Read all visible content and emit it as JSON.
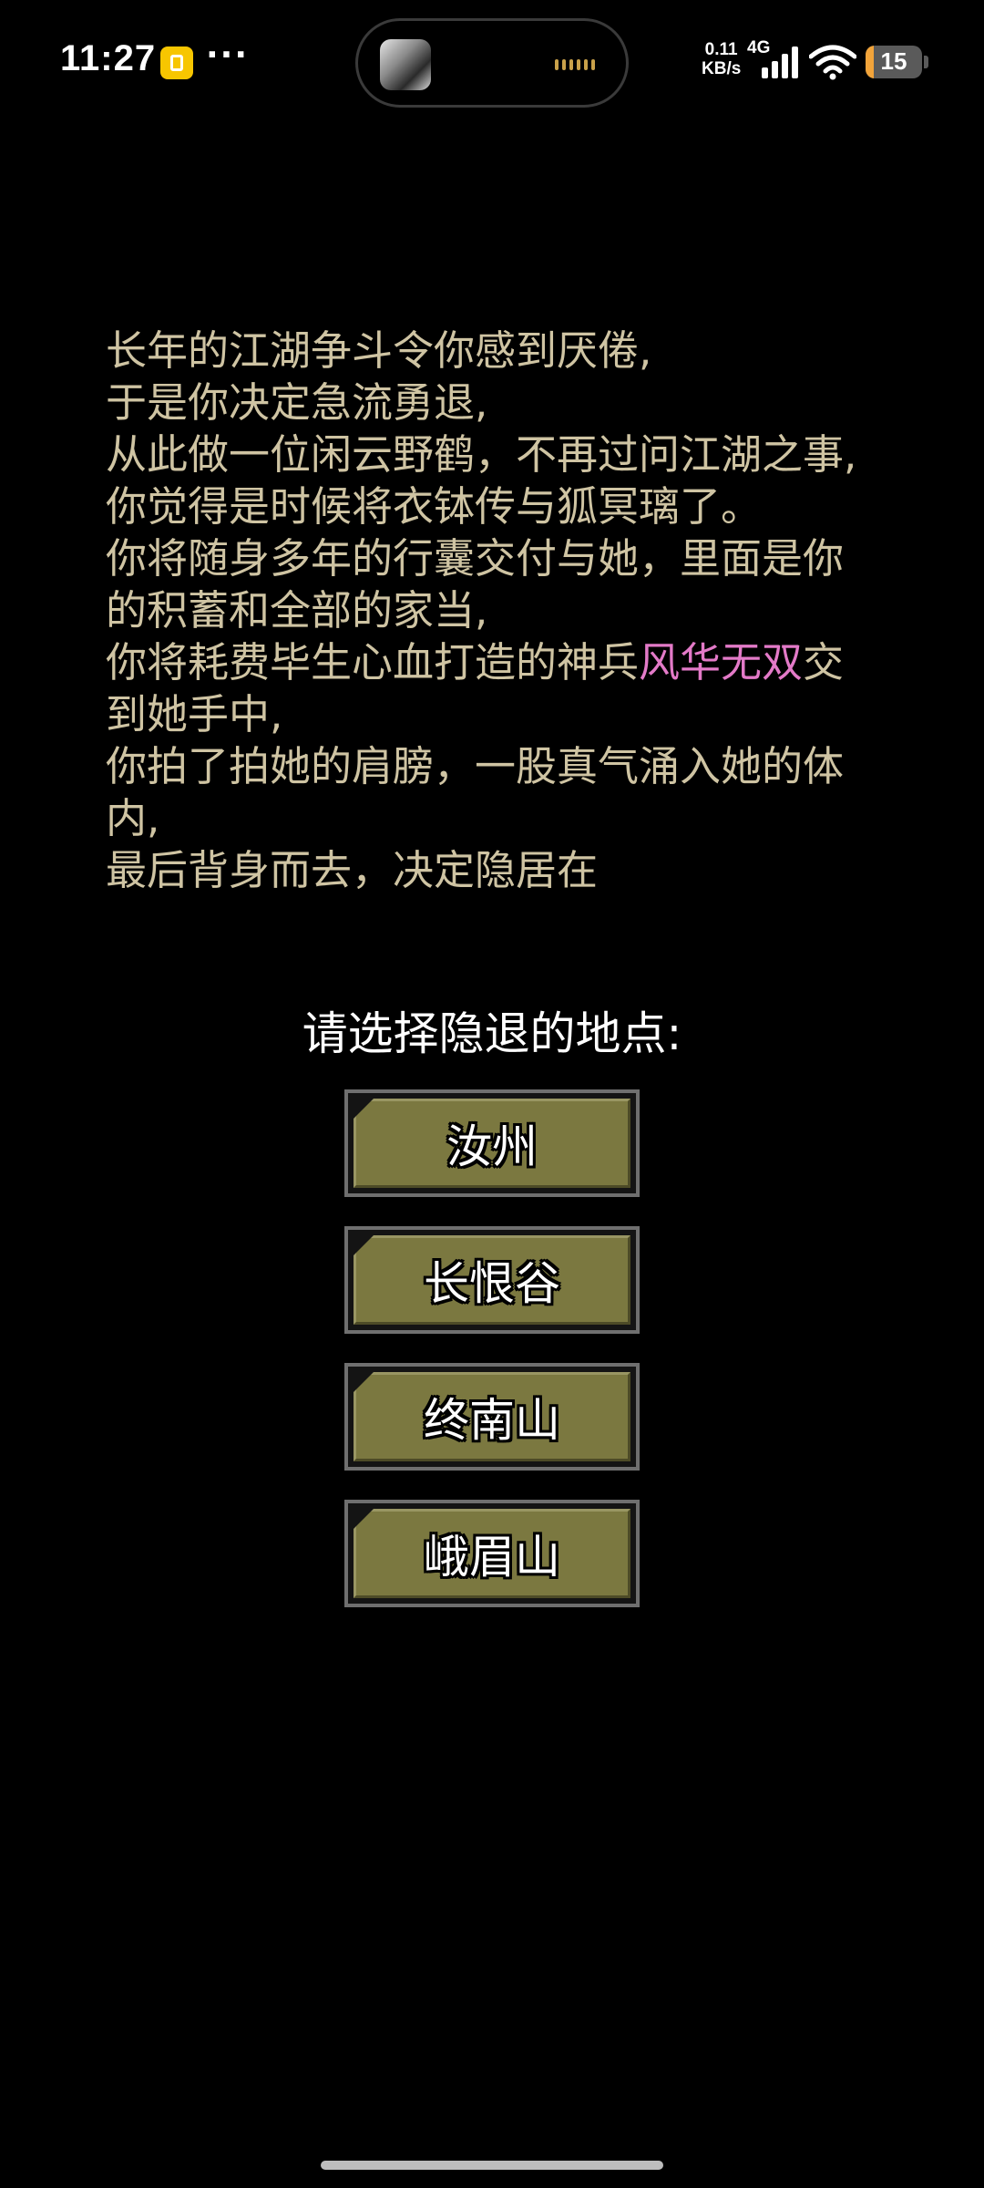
{
  "status_bar": {
    "time": "11:27",
    "more": "···",
    "net_speed_value": "0.11",
    "net_speed_unit": "KB/s",
    "net_type": "4G",
    "battery": "15",
    "battery_level_percent": 15,
    "battery_color": "#f2a43a",
    "icons": [
      "app-notification-icon",
      "signal-icon",
      "wifi-icon",
      "battery-icon"
    ]
  },
  "story": {
    "lines": [
      "长年的江湖争斗令你感到厌倦,",
      "于是你决定急流勇退,",
      "从此做一位闲云野鹤，不再过问江湖之事,",
      "你觉得是时候将衣钵传与狐冥璃了。",
      "你将随身多年的行囊交付与她，里面是你的积蓄和全部的家当,"
    ],
    "weapon_line_before": "你将耗费毕生心血打造的神兵",
    "weapon_name": "风华无双",
    "weapon_line_after": "交到她手中,",
    "lines_after": [
      "你拍了拍她的肩膀，一股真气涌入她的体内,",
      "最后背身而去，决定隐居在"
    ],
    "text_color": "#cfc4a3",
    "weapon_color": "#e37ac8"
  },
  "prompt": "请选择隐退的地点:",
  "choices": [
    {
      "label": "汝州"
    },
    {
      "label": "长恨谷"
    },
    {
      "label": "终南山"
    },
    {
      "label": "峨眉山"
    }
  ],
  "button_color": "#7b7840"
}
